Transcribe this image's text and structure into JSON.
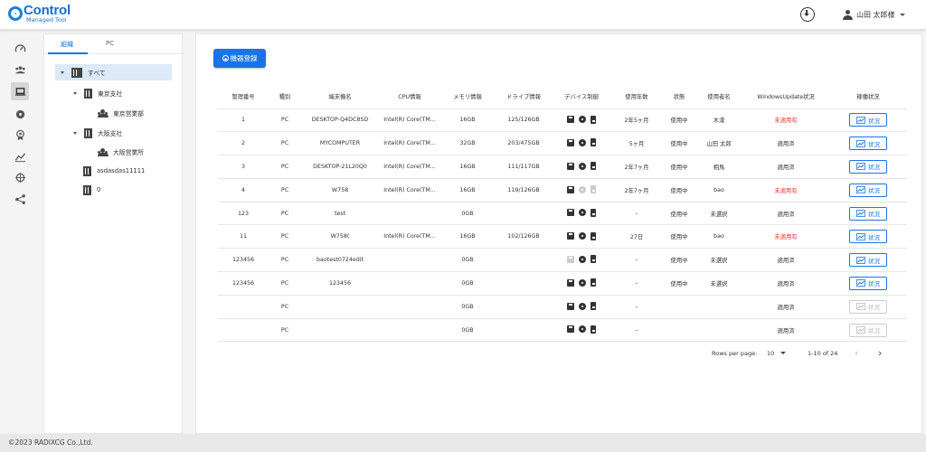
{
  "header": {
    "logo_title": "Control",
    "logo_subtitle": "Managed Tool",
    "user_name": "山田 太郎様"
  },
  "rail": {
    "items": [
      "speedometer-icon",
      "group-icon",
      "laptop-icon",
      "disc-icon",
      "badge-icon",
      "chart-icon",
      "crosshair-icon",
      "share-icon"
    ]
  },
  "tree": {
    "tabs": [
      "組織",
      "PC"
    ],
    "active_tab": 0,
    "nodes": [
      {
        "label": "すべて",
        "level": 0,
        "icon": "building-icon",
        "expanded": true,
        "selected": true
      },
      {
        "label": "東京支社",
        "level": 1,
        "icon": "building-icon",
        "expanded": true
      },
      {
        "label": "東京営業部",
        "level": 2,
        "icon": "group-icon"
      },
      {
        "label": "大阪支社",
        "level": 1,
        "icon": "building-icon",
        "expanded": true
      },
      {
        "label": "大阪営業所",
        "level": 2,
        "icon": "group-icon"
      },
      {
        "label": "asdasdas11111",
        "level": 1,
        "icon": "building-icon"
      },
      {
        "label": "0",
        "level": 1,
        "icon": "building-icon"
      }
    ]
  },
  "main": {
    "register_button": "機器登録",
    "columns": [
      "管理番号",
      "種別",
      "端末機名",
      "CPU情報",
      "メモリ情報",
      "ドライブ情報",
      "デバイス制御",
      "使用年数",
      "状態",
      "使用者名",
      "WindowsUpdate状況",
      "稼働状況"
    ],
    "status_button_label": "状況",
    "rows": [
      {
        "id": "1",
        "type": "PC",
        "name": "DESKTOP-Q4DC8SD",
        "cpu": "Intel(R) Core(TM...",
        "memory": "16GB",
        "drive": "125/126GB",
        "save_dim": false,
        "years": "2年5ヶ月",
        "state": "使用中",
        "user": "木漠",
        "update": "未適用有",
        "update_red": true,
        "status_enabled": true
      },
      {
        "id": "2",
        "type": "PC",
        "name": "MYCOMPUTER",
        "cpu": "Intel(R) Core(TM...",
        "memory": "32GB",
        "drive": "203/475GB",
        "save_dim": false,
        "years": "5ヶ月",
        "state": "使用中",
        "user": "山田 太郎",
        "update": "適用済",
        "update_red": false,
        "status_enabled": true
      },
      {
        "id": "3",
        "type": "PC",
        "name": "DESKTOP-21L20Q0",
        "cpu": "Intel(R) Core(TM...",
        "memory": "16GB",
        "drive": "111/117GB",
        "save_dim": false,
        "years": "2年7ヶ月",
        "state": "使用中",
        "user": "相馬",
        "update": "適用済",
        "update_red": false,
        "status_enabled": true
      },
      {
        "id": "4",
        "type": "PC",
        "name": "W758",
        "cpu": "Intel(R) Core(TM...",
        "memory": "16GB",
        "drive": "119/126GB",
        "save_dim": false,
        "disc_dim": true,
        "usb_dim": true,
        "years": "2年7ヶ月",
        "state": "使用中",
        "user": "bao",
        "update": "未適用有",
        "update_red": true,
        "status_enabled": true
      },
      {
        "id": "123",
        "type": "PC",
        "name": "test",
        "cpu": "",
        "memory": "0GB",
        "drive": "",
        "save_dim": false,
        "years": "–",
        "state": "使用中",
        "user": "未選択",
        "update": "適用済",
        "update_red": false,
        "status_enabled": true
      },
      {
        "id": "11",
        "type": "PC",
        "name": "W758(",
        "cpu": "Intel(R) Core(TM...",
        "memory": "16GB",
        "drive": "102/126GB",
        "save_dim": false,
        "years": "27日",
        "state": "使用中",
        "user": "bao",
        "update": "未適用有",
        "update_red": true,
        "status_enabled": true
      },
      {
        "id": "123456",
        "type": "PC",
        "name": "baotest0724edit",
        "cpu": "",
        "memory": "0GB",
        "drive": "",
        "save_dim": true,
        "years": "–",
        "state": "使用中",
        "user": "未選択",
        "update": "適用済",
        "update_red": false,
        "status_enabled": true
      },
      {
        "id": "123456",
        "type": "PC",
        "name": "123456",
        "cpu": "",
        "memory": "0GB",
        "drive": "",
        "save_dim": false,
        "years": "–",
        "state": "使用中",
        "user": "未選択",
        "update": "適用済",
        "update_red": false,
        "status_enabled": true
      },
      {
        "id": "",
        "type": "PC",
        "name": "",
        "cpu": "",
        "memory": "0GB",
        "drive": "",
        "save_dim": false,
        "years": "–",
        "state": "",
        "user": "",
        "update": "適用済",
        "update_red": false,
        "status_enabled": false
      },
      {
        "id": "",
        "type": "PC",
        "name": "",
        "cpu": "",
        "memory": "0GB",
        "drive": "",
        "save_dim": false,
        "years": "–",
        "state": "",
        "user": "",
        "update": "適用済",
        "update_red": false,
        "status_enabled": false
      }
    ],
    "pagination": {
      "rows_per_page_label": "Rows per page:",
      "rows_per_page": "10",
      "range": "1-10 of 24"
    }
  },
  "colors": {
    "accent": "#1a73e8",
    "warning": "#e53935"
  },
  "footer": {
    "copyright": "©2023 RADIXCG Co.,Ltd."
  }
}
